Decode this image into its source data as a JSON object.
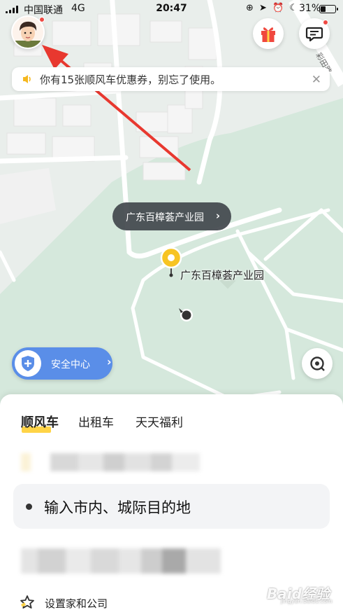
{
  "status_bar": {
    "carrier": "中国联通",
    "network": "4G",
    "time": "20:47",
    "status_icons": "⊕ ➤ ⏰ ☾",
    "battery_percent": "31%"
  },
  "notice": {
    "text": "你有15张顺风车优惠券，别忘了使用。",
    "close_glyph": "✕"
  },
  "map": {
    "location_pill_label": "广东百樟荟产业园",
    "location_pill_chevron": "›",
    "poi_label": "广东百樟荟产业园",
    "road_label": "彩田路",
    "colors": {
      "land": "#e7eee9",
      "green": "#d6e9dd",
      "building": "#f4f4f4",
      "road": "#ffffff",
      "pin": "#f7c423"
    }
  },
  "safety_button": {
    "label": "安全中心",
    "chevron": "›"
  },
  "tabs": [
    {
      "label": "顺风车",
      "active": true
    },
    {
      "label": "出租车",
      "active": false
    },
    {
      "label": "天天福利",
      "active": false
    }
  ],
  "destination": {
    "placeholder": "输入市内、城际目的地"
  },
  "set_home": {
    "label": "设置家和公司"
  },
  "watermark": {
    "brand": "Baid经验",
    "url": "jingyan.baidu.com"
  },
  "accent_colors": {
    "tab_highlight": "#ffd447",
    "safety_blue": "#5a8ee8",
    "arrow_red": "#e8382f",
    "badge_red": "#ef4a43"
  }
}
